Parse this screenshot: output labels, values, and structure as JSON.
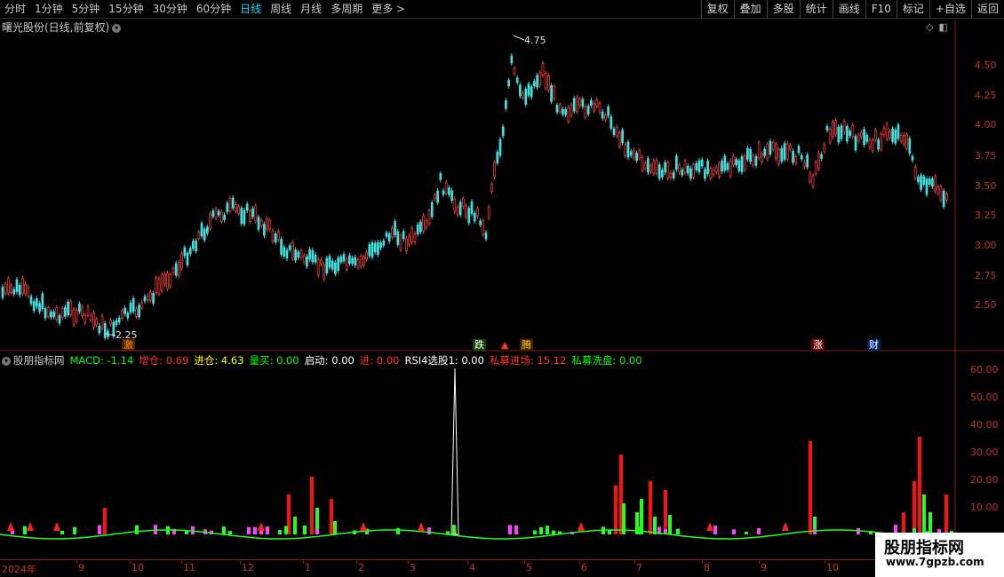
{
  "toolbar": {
    "timeframes": [
      "分时",
      "1分钟",
      "5分钟",
      "15分钟",
      "30分钟",
      "60分钟",
      "日线",
      "周线",
      "月线",
      "多周期",
      "更多 >"
    ],
    "right_buttons": [
      "复权",
      "叠加",
      "多股",
      "统计",
      "画线",
      "F10",
      "标记",
      "+自选",
      "返回"
    ]
  },
  "main_chart": {
    "title": "曙光股份(日线,前复权)",
    "high_label": "4.75",
    "low_label": "2.25",
    "price_axis": [
      "4.50",
      "4.25",
      "4.00",
      "3.75",
      "3.50",
      "3.25",
      "3.00",
      "2.75",
      "2.50"
    ],
    "markers": [
      {
        "text": "激",
        "color": "#ff8c00",
        "bg": "#552200"
      },
      {
        "text": "跌",
        "color": "#ffffff",
        "bg": "#114400"
      },
      {
        "text": "▲",
        "color": "#ff3030",
        "bg": "#000000"
      },
      {
        "text": "腾",
        "color": "#ffcc00",
        "bg": "#442200"
      },
      {
        "text": "涨",
        "color": "#ffffff",
        "bg": "#660000"
      },
      {
        "text": "财",
        "color": "#ffffff",
        "bg": "#002266"
      }
    ]
  },
  "indicator": {
    "name": "股朋指标网",
    "items": [
      {
        "label": "MACD: -1.14",
        "color": "#00ff00"
      },
      {
        "label": "增仓: 0.69",
        "color": "#ff3030"
      },
      {
        "label": "进仓: 4.63",
        "color": "#ffff00"
      },
      {
        "label": "量买: 0.00",
        "color": "#00ff00"
      },
      {
        "label": "启动: 0.00",
        "color": "#ffffff"
      },
      {
        "label": "进: 0.00",
        "color": "#ff3030"
      },
      {
        "label": "RSI4选股1: 0.00",
        "color": "#ffffff"
      },
      {
        "label": "私募进场: 15.12",
        "color": "#ff3030"
      },
      {
        "label": "私募洗盘: 0.00",
        "color": "#00ff00"
      }
    ],
    "axis": [
      "60.00",
      "50.00",
      "40.00",
      "30.00",
      "20.00",
      "10.00"
    ]
  },
  "dates": [
    "2024年",
    "9",
    "10",
    "11",
    "12",
    "1",
    "2",
    "3",
    "4",
    "5",
    "6",
    "7",
    "8",
    "9",
    "10"
  ],
  "watermark": {
    "title": "股朋指标网",
    "url": "www.7gpzb.com"
  }
}
